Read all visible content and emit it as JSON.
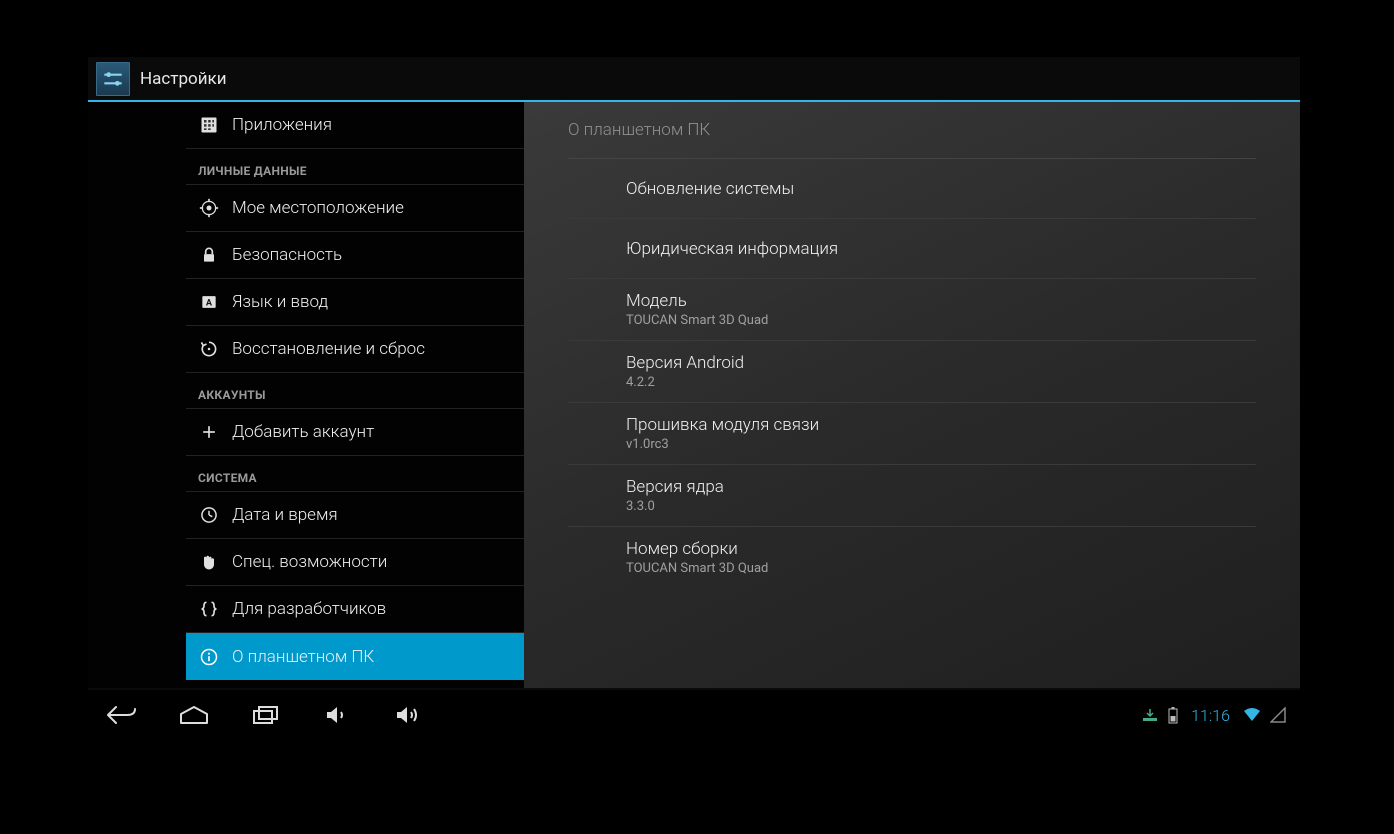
{
  "header": {
    "title": "Настройки"
  },
  "sidebar": {
    "items": [
      {
        "label": "Приложения"
      }
    ],
    "cat_personal": "ЛИЧНЫЕ ДАННЫЕ",
    "personal": [
      {
        "label": "Мое местоположение"
      },
      {
        "label": "Безопасность"
      },
      {
        "label": "Язык и ввод"
      },
      {
        "label": "Восстановление и сброс"
      }
    ],
    "cat_accounts": "АККАУНТЫ",
    "accounts": [
      {
        "label": "Добавить аккаунт"
      }
    ],
    "cat_system": "СИСТЕМА",
    "system": [
      {
        "label": "Дата и время"
      },
      {
        "label": "Спец. возможности"
      },
      {
        "label": "Для разработчиков"
      },
      {
        "label": "О планшетном ПК"
      }
    ]
  },
  "detail": {
    "header": "О планшетном ПК",
    "rows": [
      {
        "title": "Обновление системы"
      },
      {
        "title": "Юридическая информация"
      },
      {
        "title": "Модель",
        "sub": "TOUCAN Smart 3D Quad"
      },
      {
        "title": "Версия Android",
        "sub": "4.2.2"
      },
      {
        "title": "Прошивка модуля связи",
        "sub": "v1.0rc3"
      },
      {
        "title": "Версия ядра",
        "sub": "3.3.0"
      },
      {
        "title": "Номер сборки",
        "sub": "TOUCAN Smart 3D Quad"
      }
    ]
  },
  "statusbar": {
    "time": "11:16"
  }
}
